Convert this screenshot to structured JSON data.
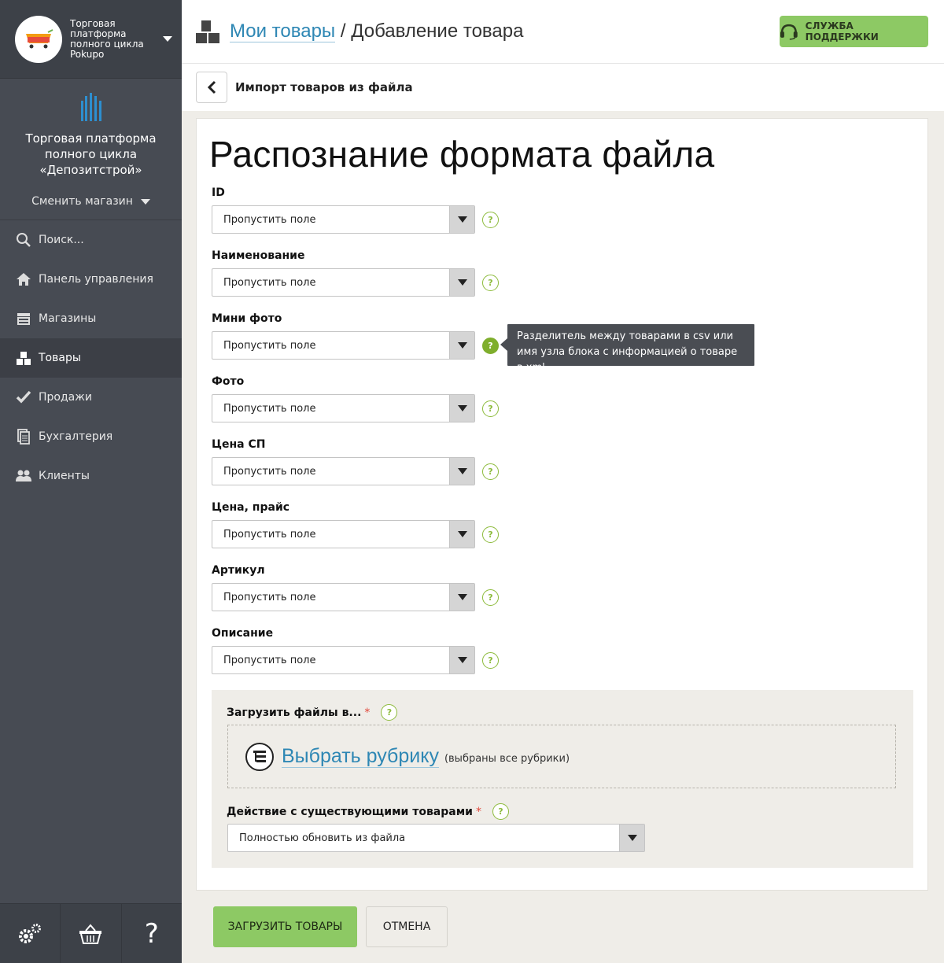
{
  "sidebar": {
    "store_name": "Торговая платформа полного цикла Pokupo",
    "brand_title": "Торговая платформа полного цикла «Депозитстрой»",
    "switch_store": "Сменить магазин",
    "nav": [
      {
        "label": "Поиск...",
        "icon": "search-icon"
      },
      {
        "label": "Панель управления",
        "icon": "home-icon"
      },
      {
        "label": "Магазины",
        "icon": "store-icon"
      },
      {
        "label": "Товары",
        "icon": "boxes-icon",
        "active": true
      },
      {
        "label": "Продажи",
        "icon": "check-icon"
      },
      {
        "label": "Бухгалтерия",
        "icon": "documents-icon"
      },
      {
        "label": "Клиенты",
        "icon": "users-icon"
      }
    ],
    "bottom": {
      "help_glyph": "?"
    }
  },
  "header": {
    "crumb_link": "Мои товары",
    "crumb_sep": " / ",
    "crumb_current": "Добавление товара",
    "support_label": "СЛУЖБА ПОДДЕРЖКИ"
  },
  "subheader": {
    "title": "Импорт товаров из файла"
  },
  "main": {
    "title": "Распознание формата файла",
    "fields": [
      {
        "label": "ID",
        "value": "Пропустить поле"
      },
      {
        "label": "Наименование",
        "value": "Пропустить поле"
      },
      {
        "label": "Мини фото",
        "value": "Пропустить поле"
      },
      {
        "label": "Фото",
        "value": "Пропустить поле"
      },
      {
        "label": "Цена СП",
        "value": "Пропустить поле"
      },
      {
        "label": "Цена, прайс",
        "value": "Пропустить поле"
      },
      {
        "label": "Артикул",
        "value": "Пропустить поле"
      },
      {
        "label": "Описание",
        "value": "Пропустить поле"
      }
    ],
    "help_glyph": "?",
    "tooltip": "Разделитель между товарами в csv или имя узла блока с информацией о товаре в xml",
    "upload": {
      "label": "Загрузить файлы в...",
      "required": "*",
      "choose_rubric": "Выбрать рубрику",
      "rubric_note": "(выбраны все рубрики)"
    },
    "existing": {
      "label": "Действие с существующими товарами",
      "required": "*",
      "value": "Полностью обновить из файла"
    }
  },
  "actions": {
    "submit": "ЗАГРУЗИТЬ ТОВАРЫ",
    "cancel": "ОТМЕНА"
  },
  "colors": {
    "accent_green": "#8dc964",
    "link_blue": "#2e87b4",
    "sidebar": "#474b53"
  }
}
